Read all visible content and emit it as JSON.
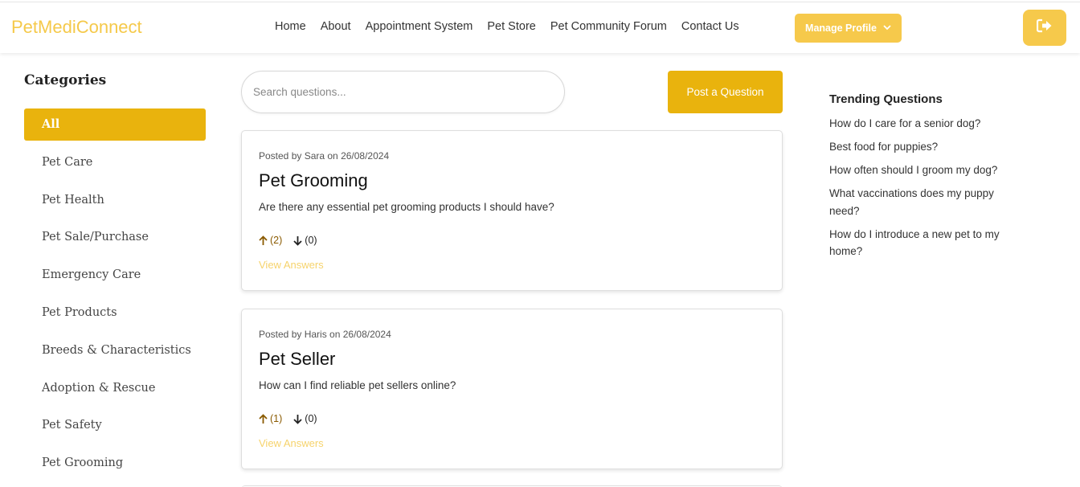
{
  "header": {
    "brand": "PetMediConnect",
    "nav": [
      "Home",
      "About",
      "Appointment System",
      "Pet Store",
      "Pet Community Forum",
      "Contact Us"
    ],
    "manage_profile": "Manage Profile",
    "accent_color": "#f6c94b"
  },
  "sidebar": {
    "title": "Categories",
    "items": [
      {
        "label": "All",
        "active": true
      },
      {
        "label": "Pet Care"
      },
      {
        "label": "Pet Health"
      },
      {
        "label": "Pet Sale/Purchase"
      },
      {
        "label": "Emergency Care"
      },
      {
        "label": "Pet Products"
      },
      {
        "label": "Breeds & Characteristics"
      },
      {
        "label": "Adoption & Rescue"
      },
      {
        "label": "Pet Safety"
      },
      {
        "label": "Pet Grooming"
      }
    ],
    "active_color": "#e9b30d"
  },
  "main": {
    "search_placeholder": "Search questions...",
    "post_button": "Post a Question",
    "questions": [
      {
        "meta": "Posted by Sara on 26/08/2024",
        "title": "Pet Grooming",
        "body": "Are there any essential pet grooming products I should have?",
        "upvotes": "(2)",
        "downvotes": "(0)",
        "answers_link": "View Answers"
      },
      {
        "meta": "Posted by Haris on 26/08/2024",
        "title": "Pet Seller",
        "body": "How can I find reliable pet sellers online?",
        "upvotes": "(1)",
        "downvotes": "(0)",
        "answers_link": "View Answers"
      }
    ]
  },
  "trending": {
    "title": "Trending Questions",
    "items": [
      "How do I care for a senior dog?",
      "Best food for puppies?",
      "How often should I groom my dog?",
      "What vaccinations does my puppy need?",
      "How do I introduce a new pet to my home?"
    ]
  }
}
